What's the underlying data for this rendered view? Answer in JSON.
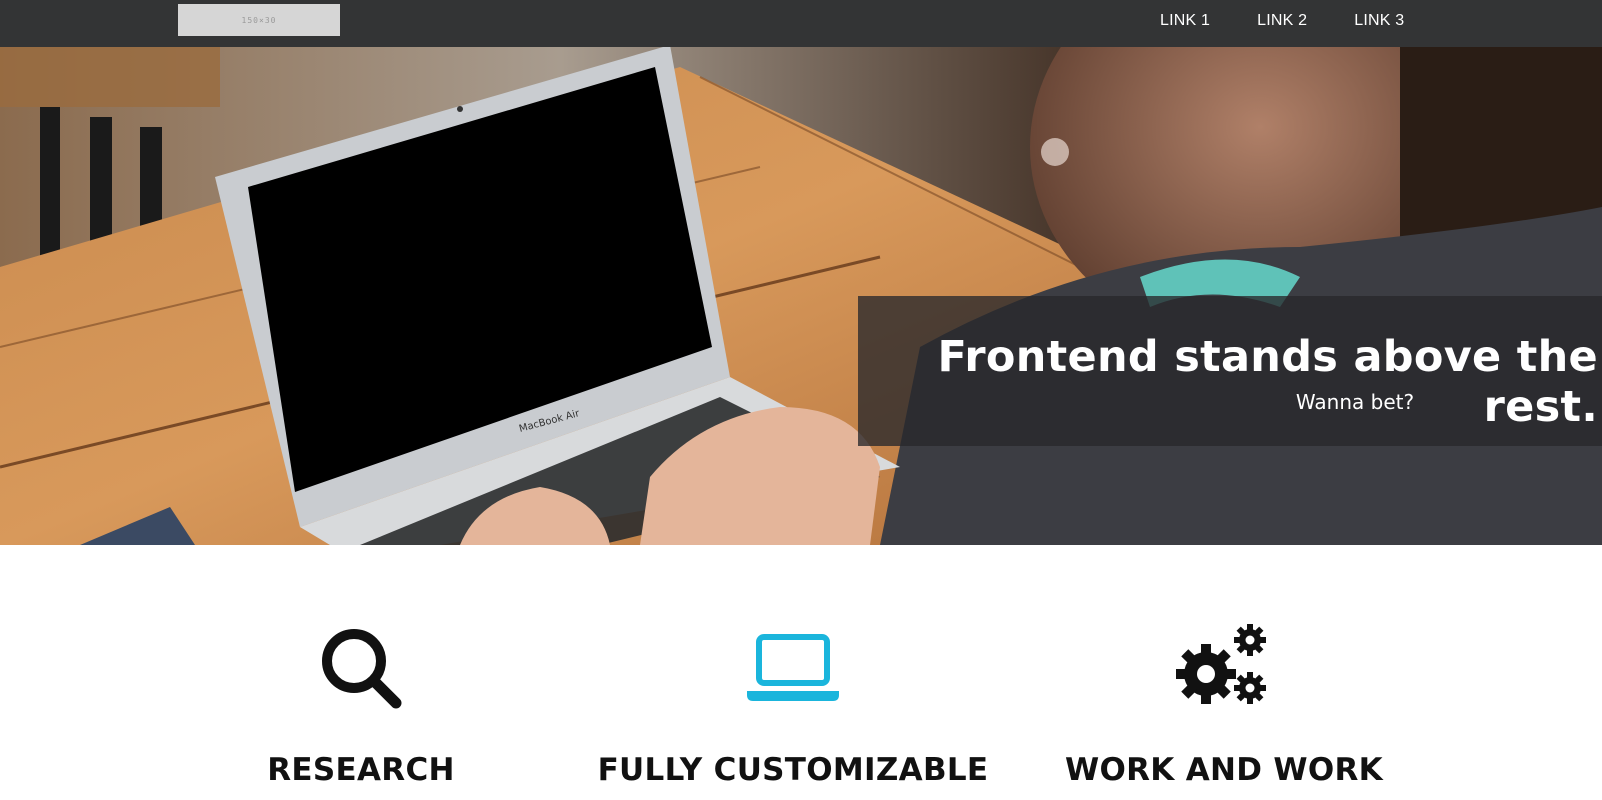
{
  "nav": {
    "logo_text": "150×30",
    "links": [
      "LINK 1",
      "LINK 2",
      "LINK 3"
    ]
  },
  "hero": {
    "title": "Frontend stands above the rest.",
    "subtitle": "Wanna bet?"
  },
  "features": [
    {
      "label": "RESEARCH",
      "icon": "search-icon",
      "color": "#111111"
    },
    {
      "label": "FULLY CUSTOMIZABLE",
      "icon": "laptop-icon",
      "color": "#1ab5dc"
    },
    {
      "label": "WORK AND WORK",
      "icon": "gears-icon",
      "color": "#111111"
    }
  ],
  "colors": {
    "nav_bg": "#333435",
    "accent": "#1ab5dc",
    "hero_overlay": "#28282c"
  }
}
